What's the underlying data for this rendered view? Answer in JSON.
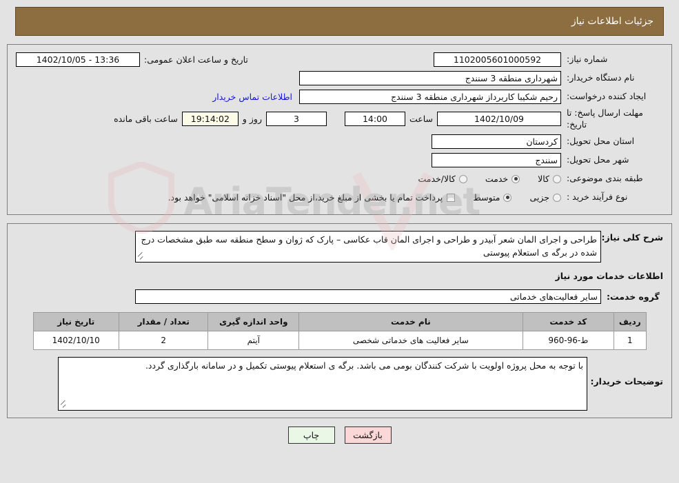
{
  "header": {
    "title": "جزئیات اطلاعات نیاز"
  },
  "top_section": {
    "need_number": {
      "label": "شماره نیاز:",
      "value": "1102005601000592"
    },
    "public_announce": {
      "label": "تاریخ و ساعت اعلان عمومی:",
      "value": "13:36 - 1402/10/05"
    },
    "buyer_org": {
      "label": "نام دستگاه خریدار:",
      "value": "شهرداری منطقه 3 سنندج"
    },
    "request_creator": {
      "label": "ایجاد کننده درخواست:",
      "value": "رحیم شکیبا کاربرداز شهرداری منطقه 3 سنندج"
    },
    "contact_link": "اطلاعات تماس خریدار",
    "response_deadline": {
      "label": "مهلت ارسال پاسخ: تا تاریخ:",
      "date": "1402/10/09",
      "hour_label": "ساعت",
      "hour": "14:00",
      "days": "3",
      "days_label": "روز و",
      "countdown": "19:14:02",
      "countdown_label": "ساعت باقی مانده"
    },
    "delivery_province": {
      "label": "استان محل تحویل:",
      "value": "کردستان"
    },
    "delivery_city": {
      "label": "شهر محل تحویل:",
      "value": "سنندج"
    },
    "subject_category": {
      "label": "طبقه بندی موضوعی:",
      "options": [
        {
          "label": "کالا",
          "selected": false
        },
        {
          "label": "خدمت",
          "selected": true
        },
        {
          "label": "کالا/خدمت",
          "selected": false
        }
      ]
    },
    "purchase_process": {
      "label": "نوع فرآیند خرید :",
      "options": [
        {
          "label": "جزیی",
          "selected": false
        },
        {
          "label": "متوسط",
          "selected": true
        }
      ],
      "treasury_checkbox": {
        "checked": false,
        "text": "پرداخت تمام یا بخشی از مبلغ خرید،از محل \"اسناد خزانه اسلامی\" خواهد بود."
      }
    }
  },
  "bottom_section": {
    "general_description": {
      "label": "شرح کلی نیاز:",
      "value": "طراحی و اجرای المان شعر آبیدر و طراحی و اجرای المان قاب عکاسی – پارک که ژوان  و سطح منطقه سه طبق مشخصات درج شده در برگه ی استعلام پیوستی"
    },
    "services_heading": "اطلاعات خدمات مورد نیاز",
    "service_group": {
      "label": "گروه خدمت:",
      "value": "سایر فعالیت‌های خدماتی"
    },
    "table": {
      "columns": [
        "ردیف",
        "کد خدمت",
        "نام خدمت",
        "واحد اندازه گیری",
        "تعداد / مقدار",
        "تاریخ نیاز"
      ],
      "rows": [
        {
          "radif": "1",
          "code": "ط-96-960",
          "name": "سایر فعالیت های خدماتی شخصی",
          "unit": "آیتم",
          "qty": "2",
          "date": "1402/10/10"
        }
      ]
    },
    "buyer_notes": {
      "label": "توضیحات خریدار:",
      "value": "با توجه به محل پروژه اولویت با شرکت کنندگان بومی می باشد. برگه ی استعلام پیوستی تکمیل و در سامانه بارگذاری گردد."
    }
  },
  "footer": {
    "print_button": "چاپ",
    "back_button": "بازگشت"
  },
  "watermark": {
    "text": "AriaTender.net"
  },
  "colors": {
    "header_bar": "#8d6e41",
    "page_background": "#e3e3e3",
    "link": "#1414d6",
    "countdown_field": "#fbfbe8",
    "print_button": "#eaf7e7",
    "back_button": "#fbd7d7",
    "table_header": "#c0c0c0"
  }
}
